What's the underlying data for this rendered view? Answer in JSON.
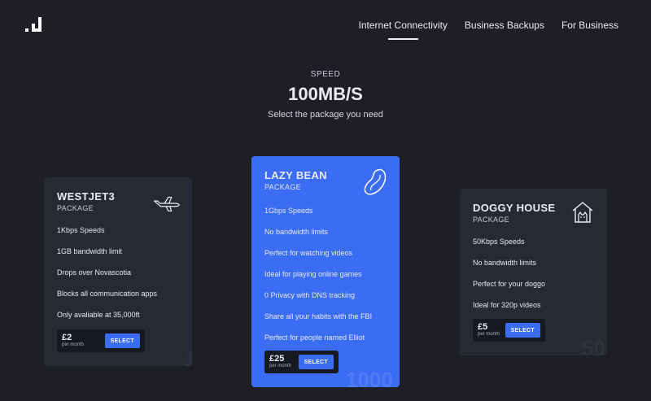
{
  "nav": {
    "items": [
      "Internet Connectivity",
      "Business Backups",
      "For Business"
    ]
  },
  "hero": {
    "kicker": "SPEED",
    "title": "100MB/S",
    "subtitle": "Select the package you need"
  },
  "cards": [
    {
      "name": "WESTJET3",
      "sub": "PACKAGE",
      "icon": "airplane-icon",
      "features": [
        "1Kbps Speeds",
        "1GB bandwidth limit",
        "Drops over Novascotia",
        "Blocks all communication apps",
        "Only avaliable at 35,000ft"
      ],
      "price": "£2",
      "per": "per month",
      "select": "SELECT",
      "bignum": "1"
    },
    {
      "name": "LAZY BEAN",
      "sub": "PACKAGE",
      "icon": "bean-icon",
      "features": [
        "1Gbps Speeds",
        "No bandwidth limits",
        "Perfect for watching videos",
        "Ideal for playing online games",
        "0 Privacy with DNS tracking",
        "Share all your habits with the FBI",
        "Perfect for people named Elliot"
      ],
      "price": "£25",
      "per": "per month",
      "select": "SELECT",
      "bignum": "1000"
    },
    {
      "name": "DOGGY HOUSE",
      "sub": "PACKAGE",
      "icon": "doghouse-icon",
      "features": [
        "50Kbps Speeds",
        "No bandwidth limits",
        "Perfect for your doggo",
        "Ideal for 320p videos"
      ],
      "price": "£5",
      "per": "per month",
      "select": "SELECT",
      "bignum": "50"
    }
  ],
  "colors": {
    "background": "#1d1f25",
    "card": "#262a34",
    "accent": "#3b6df4"
  }
}
